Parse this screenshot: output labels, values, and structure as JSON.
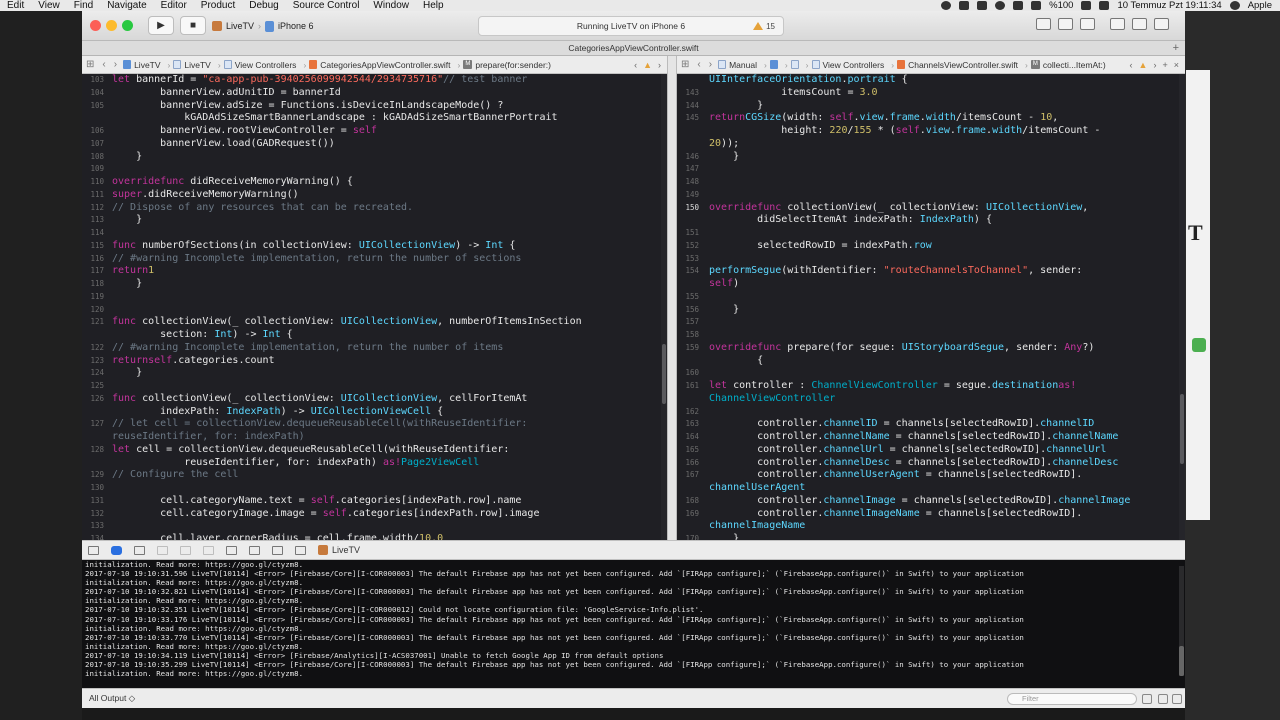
{
  "menubar": {
    "items": [
      "Edit",
      "View",
      "Find",
      "Navigate",
      "Editor",
      "Product",
      "Debug",
      "Source Control",
      "Window",
      "Help"
    ],
    "battery": "%100",
    "datetime": "10 Temmuz Pzt  19:11:34",
    "apple_label": "Apple"
  },
  "toolbar": {
    "scheme_project": "LiveTV",
    "scheme_device": "iPhone 6",
    "activity_text": "Running LiveTV on iPhone 6",
    "warnings_count": "15"
  },
  "window_title": "CategoriesAppViewController.swift",
  "left_editor": {
    "jumpbar": [
      "LiveTV",
      "LiveTV",
      "View Controllers",
      "CategoriesAppViewController.swift",
      "prepare(for:sender:)"
    ],
    "lines": [
      {
        "n": "103",
        "html": "        <span class='kw'>let</span> bannerId = <span class='st'>\"ca-app-pub-3940256099942544/2934735716\"</span> <span class='cm'>// test banner</span>"
      },
      {
        "n": "104",
        "html": "        bannerView.adUnitID = bannerId"
      },
      {
        "n": "105",
        "html": "        bannerView.adSize = Functions.isDeviceInLandscapeMode() ?"
      },
      {
        "n": "",
        "html": "            kGADAdSizeSmartBannerLandscape : kGADAdSizeSmartBannerPortrait"
      },
      {
        "n": "106",
        "html": "        bannerView.rootViewController = <span class='kw'>self</span>"
      },
      {
        "n": "107",
        "html": "        bannerView.load(GADRequest())"
      },
      {
        "n": "108",
        "html": "    }"
      },
      {
        "n": "109",
        "html": ""
      },
      {
        "n": "110",
        "html": "    <span class='kw'>override</span> <span class='kw'>func</span> didReceiveMemoryWarning() {"
      },
      {
        "n": "111",
        "html": "        <span class='kw'>super</span>.didReceiveMemoryWarning()"
      },
      {
        "n": "112",
        "html": "        <span class='cm'>// Dispose of any resources that can be recreated.</span>"
      },
      {
        "n": "113",
        "html": "    }"
      },
      {
        "n": "114",
        "html": ""
      },
      {
        "n": "115",
        "html": "    <span class='kw'>func</span> numberOfSections(in collectionView: <span class='ty'>UICollectionView</span>) -> <span class='ty'>Int</span> {"
      },
      {
        "n": "116",
        "html": "        <span class='cm'>// #warning Incomplete implementation, return the number of sections</span>"
      },
      {
        "n": "117",
        "html": "        <span class='kw'>return</span> <span class='nu'>1</span>"
      },
      {
        "n": "118",
        "html": "    }"
      },
      {
        "n": "119",
        "html": ""
      },
      {
        "n": "120",
        "html": ""
      },
      {
        "n": "121",
        "html": "    <span class='kw'>func</span> collectionView(_ collectionView: <span class='ty'>UICollectionView</span>, numberOfItemsInSection"
      },
      {
        "n": "",
        "html": "        section: <span class='ty'>Int</span>) -> <span class='ty'>Int</span> {"
      },
      {
        "n": "122",
        "html": "        <span class='cm'>// #warning Incomplete implementation, return the number of items</span>"
      },
      {
        "n": "123",
        "html": "        <span class='kw'>return</span> <span class='kw'>self</span>.categories.count"
      },
      {
        "n": "124",
        "html": "    }"
      },
      {
        "n": "125",
        "html": ""
      },
      {
        "n": "126",
        "html": "    <span class='kw'>func</span> collectionView(_ collectionView: <span class='ty'>UICollectionView</span>, cellForItemAt"
      },
      {
        "n": "",
        "html": "        indexPath: <span class='ty'>IndexPath</span>) -> <span class='ty'>UICollectionViewCell</span> {"
      },
      {
        "n": "127",
        "html": "        <span class='cm'>// let cell = collectionView.dequeueReusableCell(withReuseIdentifier:</span>"
      },
      {
        "n": "",
        "html": "            <span class='cm'>reuseIdentifier, for: indexPath)</span>"
      },
      {
        "n": "128",
        "html": "        <span class='kw'>let</span> cell = collectionView.dequeueReusableCell(withReuseIdentifier:"
      },
      {
        "n": "",
        "html": "            reuseIdentifier, for: indexPath) <span class='kw'>as!</span> <span class='tp'>Page2ViewCell</span>"
      },
      {
        "n": "129",
        "html": "        <span class='cm'>// Configure the cell</span>"
      },
      {
        "n": "130",
        "html": ""
      },
      {
        "n": "131",
        "html": "        cell.categoryName.text = <span class='kw'>self</span>.categories[indexPath.row].name"
      },
      {
        "n": "132",
        "html": "        cell.categoryImage.image = <span class='kw'>self</span>.categories[indexPath.row].image"
      },
      {
        "n": "133",
        "html": ""
      },
      {
        "n": "134",
        "html": "        cell.layer.cornerRadius = cell.frame.width/<span class='nu'>10.0</span>"
      }
    ]
  },
  "right_editor": {
    "jumpbar": [
      "Manual",
      "LiveTV",
      "View Controllers",
      "ChannelsViewController.swift",
      "collecti...ItemAt:)"
    ],
    "lines": [
      {
        "n": "",
        "html": "            <span class='ty'>UIInterfaceOrientation</span>.<span class='ty'>portrait</span> {"
      },
      {
        "n": "143",
        "html": "            itemsCount = <span class='nu'>3.0</span>"
      },
      {
        "n": "144",
        "html": "        }"
      },
      {
        "n": "145",
        "html": "        <span class='kw'>return</span> <span class='ty'>CGSize</span>(width: <span class='kw'>self</span>.<span class='ty'>view</span>.<span class='ty'>frame</span>.<span class='ty'>width</span>/itemsCount - <span class='nu'>10</span>,"
      },
      {
        "n": "",
        "html": "            height: <span class='nu'>220</span>/<span class='nu'>155</span> * (<span class='kw'>self</span>.<span class='ty'>view</span>.<span class='ty'>frame</span>.<span class='ty'>width</span>/itemsCount -"
      },
      {
        "n": "",
        "html": "            <span class='nu'>20</span>));"
      },
      {
        "n": "146",
        "html": "    }"
      },
      {
        "n": "147",
        "html": ""
      },
      {
        "n": "148",
        "html": ""
      },
      {
        "n": "149",
        "html": ""
      },
      {
        "n": "150",
        "html": "    <span class='kw'>override</span> <span class='kw'>func</span> collectionView(_ collectionView: <span class='ty'>UICollectionView</span>,"
      },
      {
        "n": "",
        "html": "        didSelectItemAt indexPath: <span class='ty'>IndexPath</span>) {"
      },
      {
        "n": "151",
        "html": ""
      },
      {
        "n": "152",
        "html": "        selectedRowID = indexPath.<span class='ty'>row</span>"
      },
      {
        "n": "153",
        "html": ""
      },
      {
        "n": "154",
        "html": "        <span class='ty'>performSegue</span>(withIdentifier: <span class='st'>\"routeChannelsToChannel\"</span>, sender:"
      },
      {
        "n": "",
        "html": "            <span class='kw'>self</span>)"
      },
      {
        "n": "155",
        "html": ""
      },
      {
        "n": "156",
        "html": "    }"
      },
      {
        "n": "157",
        "html": ""
      },
      {
        "n": "158",
        "html": ""
      },
      {
        "n": "159",
        "html": "    <span class='kw'>override</span> <span class='kw'>func</span> prepare(for segue: <span class='ty'>UIStoryboardSegue</span>, sender: <span class='kw'>Any</span>?)"
      },
      {
        "n": "",
        "html": "        {"
      },
      {
        "n": "160",
        "html": ""
      },
      {
        "n": "161",
        "html": "        <span class='kw'>let</span> controller : <span class='tp'>ChannelViewController</span> = segue.<span class='ty'>destination</span> <span class='kw'>as!</span>"
      },
      {
        "n": "",
        "html": "            <span class='tp'>ChannelViewController</span>"
      },
      {
        "n": "162",
        "html": ""
      },
      {
        "n": "163",
        "html": "        controller.<span class='ty'>channelID</span> = channels[selectedRowID].<span class='ty'>channelID</span>"
      },
      {
        "n": "164",
        "html": "        controller.<span class='ty'>channelName</span> = channels[selectedRowID].<span class='ty'>channelName</span>"
      },
      {
        "n": "165",
        "html": "        controller.<span class='ty'>channelUrl</span> = channels[selectedRowID].<span class='ty'>channelUrl</span>"
      },
      {
        "n": "166",
        "html": "        controller.<span class='ty'>channelDesc</span> = channels[selectedRowID].<span class='ty'>channelDesc</span>"
      },
      {
        "n": "167",
        "html": "        controller.<span class='ty'>channelUserAgent</span> = channels[selectedRowID]."
      },
      {
        "n": "",
        "html": "            <span class='ty'>channelUserAgent</span>"
      },
      {
        "n": "168",
        "html": "        controller.<span class='ty'>channelImage</span> = channels[selectedRowID].<span class='ty'>channelImage</span>"
      },
      {
        "n": "169",
        "html": "        controller.<span class='ty'>channelImageName</span> = channels[selectedRowID]."
      },
      {
        "n": "",
        "html": "            <span class='ty'>channelImageName</span>"
      },
      {
        "n": "170",
        "html": "    }"
      }
    ]
  },
  "debug_bar": {
    "target": "LiveTV"
  },
  "console": {
    "lines": [
      "initialization. Read more: https://goo.gl/ctyzm8.",
      "2017-07-10 19:10:31.596 LiveTV[10114] <Error> [Firebase/Core][I-COR000003] The default Firebase app has not yet been configured. Add `[FIRApp configure];` (`FirebaseApp.configure()` in Swift) to your application",
      "initialization. Read more: https://goo.gl/ctyzm8.",
      "2017-07-10 19:10:32.821 LiveTV[10114] <Error> [Firebase/Core][I-COR000003] The default Firebase app has not yet been configured. Add `[FIRApp configure];` (`FirebaseApp.configure()` in Swift) to your application",
      "initialization. Read more: https://goo.gl/ctyzm8.",
      "2017-07-10 19:10:32.351 LiveTV[10114] <Error> [Firebase/Core][I-COR000012] Could not locate configuration file: 'GoogleService-Info.plist'.",
      "2017-07-10 19:10:33.176 LiveTV[10114] <Error> [Firebase/Core][I-COR000003] The default Firebase app has not yet been configured. Add `[FIRApp configure];` (`FirebaseApp.configure()` in Swift) to your application",
      "initialization. Read more: https://goo.gl/ctyzm8.",
      "2017-07-10 19:10:33.770 LiveTV[10114] <Error> [Firebase/Core][I-COR000003] The default Firebase app has not yet been configured. Add `[FIRApp configure];` (`FirebaseApp.configure()` in Swift) to your application",
      "initialization. Read more: https://goo.gl/ctyzm8.",
      "2017-07-10 19:10:34.119 LiveTV[10114] <Error> [Firebase/Analytics][I-ACS037001] Unable to fetch Google App ID from default options",
      "2017-07-10 19:10:35.299 LiveTV[10114] <Error> [Firebase/Core][I-COR000003] The default Firebase app has not yet been configured. Add `[FIRApp configure];` (`FirebaseApp.configure()` in Swift) to your application",
      "initialization. Read more: https://goo.gl/ctyzm8."
    ]
  },
  "filter": {
    "output_selector": "All Output ◇",
    "placeholder": "Filter"
  }
}
